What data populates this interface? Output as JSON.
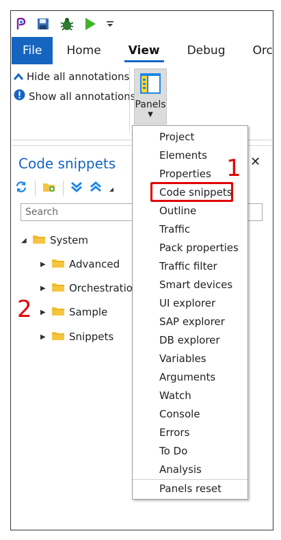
{
  "ribbon_tabs": [
    "File",
    "Home",
    "View",
    "Debug",
    "Orchestrat"
  ],
  "annotations": {
    "hide": "Hide all annotations",
    "show": "Show all annotations"
  },
  "panels_button": {
    "label": "Panels"
  },
  "panel": {
    "title": "Code snippets",
    "search_placeholder": "Search"
  },
  "tree": {
    "root": "System",
    "children": [
      "Advanced",
      "Orchestration",
      "Sample",
      "Snippets"
    ]
  },
  "menu_items": [
    "Project",
    "Elements",
    "Properties",
    "Code snippets",
    "Outline",
    "Traffic",
    "Pack properties",
    "Traffic filter",
    "Smart devices",
    "UI explorer",
    "SAP explorer",
    "DB explorer",
    "Variables",
    "Arguments",
    "Watch",
    "Console",
    "Errors",
    "To Do",
    "Analysis",
    "Panels reset"
  ],
  "callouts": {
    "one": "1",
    "two": "2"
  },
  "colors": {
    "accent": "#1565c0",
    "callout": "#e00000",
    "folder": "#f5c542"
  }
}
